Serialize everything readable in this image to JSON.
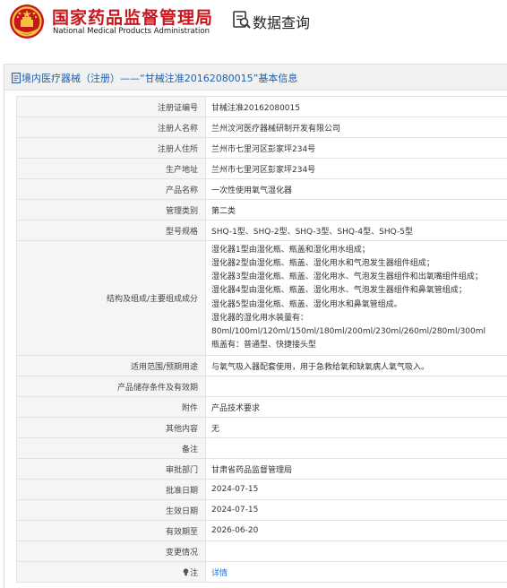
{
  "header": {
    "org_name_cn": "国家药品监督管理局",
    "org_name_en": "National Medical Products Administration",
    "query_title": "数据查询"
  },
  "colors": {
    "brand_red": "#c8161d",
    "title_blue": "#1e5fa8",
    "link_blue": "#1e6fd9"
  },
  "icons": {
    "emblem": "national-emblem-icon",
    "query": "document-search-icon",
    "panel": "document-icon",
    "note": "lightbulb-icon"
  },
  "panel": {
    "title": "境内医疗器械（注册）——“甘械注准20162080015”基本信息"
  },
  "rows": [
    {
      "label": "注册证编号",
      "value": "甘械注准20162080015"
    },
    {
      "label": "注册人名称",
      "value": "兰州汶河医疗器械研制开发有限公司"
    },
    {
      "label": "注册人住所",
      "value": "兰州市七里河区彭家坪234号"
    },
    {
      "label": "生产地址",
      "value": "兰州市七里河区彭家坪234号"
    },
    {
      "label": "产品名称",
      "value": "一次性使用氧气湿化器"
    },
    {
      "label": "管理类别",
      "value": "第二类"
    },
    {
      "label": "型号规格",
      "value": "SHQ-1型、SHQ-2型、SHQ-3型、SHQ-4型、SHQ-5型"
    },
    {
      "label": "结构及组成/主要组成成分",
      "lines": [
        "湿化器1型由湿化瓶、瓶盖和湿化用水组成；",
        "湿化器2型由湿化瓶、瓶盖、湿化用水和气泡发生器组件组成；",
        "湿化器3型由湿化瓶、瓶盖、湿化用水、气泡发生器组件和出氧嘴组件组成；",
        "湿化器4型由湿化瓶、瓶盖、湿化用水、气泡发生器组件和鼻氧管组成；",
        "湿化器5型由湿化瓶、瓶盖、湿化用水和鼻氧管组成。",
        "湿化器的湿化用水装量有：",
        "80ml/100ml/120ml/150ml/180ml/200ml/230ml/260ml/280ml/300ml",
        "瓶盖有：普通型、快捷接头型"
      ]
    },
    {
      "label": "适用范围/预期用途",
      "value": "与氧气吸入器配套使用，用于急救给氧和缺氧病人氧气吸入。"
    },
    {
      "label": "产品储存条件及有效期",
      "value": ""
    },
    {
      "label": "附件",
      "value": "产品技术要求"
    },
    {
      "label": "其他内容",
      "value": "无"
    },
    {
      "label": "备注",
      "value": ""
    },
    {
      "label": "审批部门",
      "value": "甘肃省药品监督管理局"
    },
    {
      "label": "批准日期",
      "value": "2024-07-15"
    },
    {
      "label": "生效日期",
      "value": "2024-07-15"
    },
    {
      "label": "有效期至",
      "value": "2026-06-20"
    },
    {
      "label": "变更情况",
      "value": ""
    },
    {
      "label": "注",
      "value": "详情"
    }
  ]
}
